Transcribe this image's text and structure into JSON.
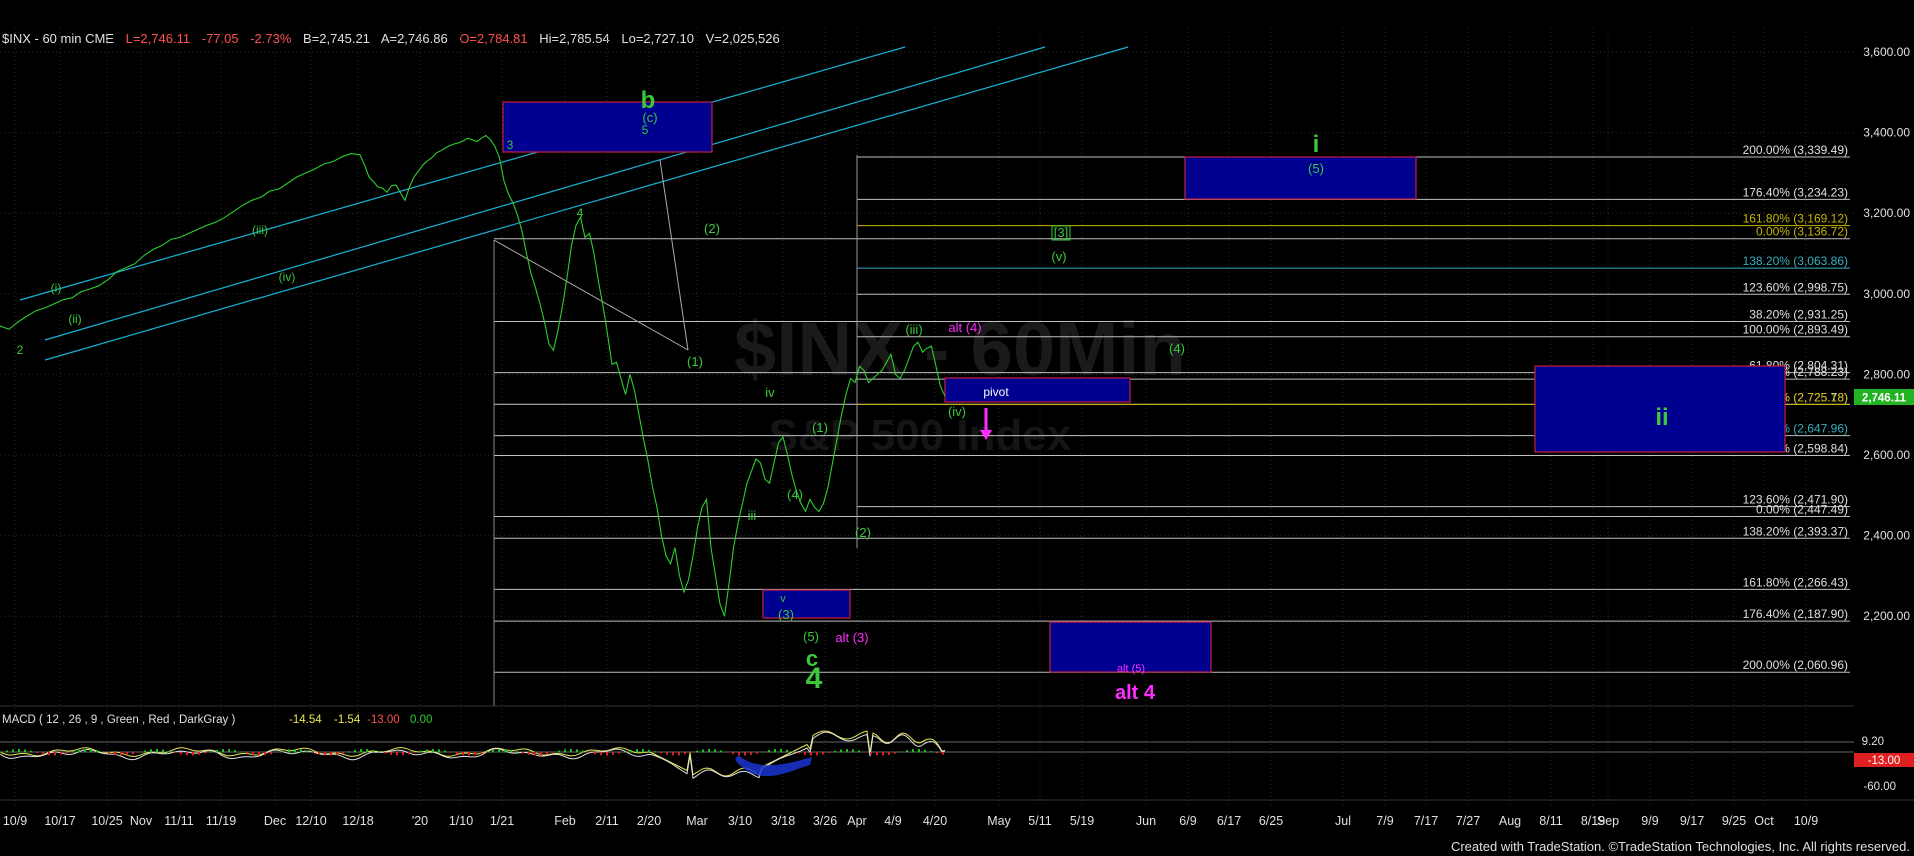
{
  "header": {
    "symbol": "$INX - 60 min  CME",
    "last": "L=2,746.11",
    "change": "-77.05",
    "pct": "-2.73%",
    "bid": "B=2,745.21",
    "ask": "A=2,746.86",
    "open": "O=2,784.81",
    "high": "Hi=2,785.54",
    "low": "Lo=2,727.10",
    "volume": "V=2,025,526"
  },
  "watermark": {
    "line1": "$INX - 60Min",
    "line2": "S&P 500 Index"
  },
  "macd": {
    "label": "MACD ( 12 , 26 , 9 , Green , Red , DarkGray )",
    "v1": "-14.54",
    "v2": "-1.54",
    "v3": "-13.00",
    "v4": "0.00",
    "axis_top": "9.20",
    "axis_last": "-13.00",
    "axis_bottom": "-60.00"
  },
  "footer": "Created with TradeStation. ©TradeStation Technologies, Inc. All rights reserved.",
  "colors": {
    "price": "#2ecc2e",
    "channel": "#17b3d8",
    "fib_line": "#c0c0c0",
    "box_fill": "#000090",
    "box_border": "#c02040",
    "wave_green": "#3cc83c",
    "wave_magenta": "#ff2cff",
    "last_price_bg": "#22b222"
  },
  "chart_data": {
    "type": "line",
    "title": "$INX - 60 min",
    "y_axis": {
      "ticks": [
        3600,
        3400,
        3200,
        3000,
        2800,
        2600,
        2400,
        2200
      ],
      "tick_labels": [
        "3,600.00",
        "3,400.00",
        "3,200.00",
        "3,000.00",
        "2,800.00",
        "2,600.00",
        "2,400.00",
        "2,200.00"
      ],
      "ylim": [
        2005,
        3610
      ]
    },
    "x_axis": {
      "labels": [
        "10/9",
        "10/17",
        "10/25",
        "Nov",
        "11/11",
        "11/19",
        "Dec",
        "12/10",
        "12/18",
        "'20",
        "1/10",
        "1/21",
        "Feb",
        "2/11",
        "2/20",
        "Mar",
        "3/10",
        "3/18",
        "3/26",
        "Apr",
        "4/9",
        "4/20",
        "May",
        "5/11",
        "5/19",
        "Jun",
        "6/9",
        "6/17",
        "6/25",
        "Jul",
        "7/9",
        "7/17",
        "7/27",
        "Aug",
        "8/11",
        "8/19",
        "Sep",
        "9/9",
        "9/17",
        "9/25",
        "Oct",
        "10/9"
      ]
    },
    "last_price": {
      "value": 2746.11,
      "label": "2,746.11"
    },
    "series": [
      {
        "values": [
          [
            0,
            2920
          ],
          [
            2,
            2912
          ],
          [
            4,
            2930
          ],
          [
            6,
            2945
          ],
          [
            8,
            2958
          ],
          [
            10,
            2965
          ],
          [
            12,
            2975
          ],
          [
            14,
            2985
          ],
          [
            16,
            2990
          ],
          [
            18,
            3005
          ],
          [
            20,
            3012
          ],
          [
            22,
            3020
          ],
          [
            24,
            3035
          ],
          [
            26,
            3055
          ],
          [
            28,
            3065
          ],
          [
            30,
            3075
          ],
          [
            32,
            3095
          ],
          [
            34,
            3110
          ],
          [
            36,
            3120
          ],
          [
            38,
            3135
          ],
          [
            40,
            3140
          ],
          [
            42,
            3150
          ],
          [
            44,
            3160
          ],
          [
            46,
            3170
          ],
          [
            48,
            3178
          ],
          [
            50,
            3190
          ],
          [
            52,
            3205
          ],
          [
            54,
            3220
          ],
          [
            56,
            3232
          ],
          [
            58,
            3240
          ],
          [
            60,
            3255
          ],
          [
            62,
            3260
          ],
          [
            64,
            3275
          ],
          [
            66,
            3290
          ],
          [
            68,
            3300
          ],
          [
            70,
            3310
          ],
          [
            72,
            3322
          ],
          [
            74,
            3328
          ],
          [
            76,
            3340
          ],
          [
            78,
            3348
          ],
          [
            80,
            3345
          ],
          [
            81,
            3320
          ],
          [
            82,
            3290
          ],
          [
            83,
            3278
          ],
          [
            84,
            3265
          ],
          [
            85,
            3262
          ],
          [
            86,
            3252
          ],
          [
            87,
            3268
          ],
          [
            88,
            3270
          ],
          [
            89,
            3250
          ],
          [
            90,
            3232
          ],
          [
            91,
            3265
          ],
          [
            92,
            3290
          ],
          [
            93,
            3305
          ],
          [
            94,
            3320
          ],
          [
            95,
            3330
          ],
          [
            96,
            3338
          ],
          [
            97,
            3350
          ],
          [
            98,
            3355
          ],
          [
            99,
            3362
          ],
          [
            100,
            3368
          ],
          [
            101,
            3372
          ],
          [
            102,
            3375
          ],
          [
            103,
            3380
          ],
          [
            104,
            3386
          ],
          [
            105,
            3382
          ],
          [
            106,
            3378
          ],
          [
            107,
            3386
          ],
          [
            108,
            3393
          ],
          [
            109,
            3382
          ],
          [
            110,
            3365
          ],
          [
            111,
            3337
          ],
          [
            112,
            3280
          ],
          [
            113,
            3248
          ],
          [
            114,
            3225
          ],
          [
            115,
            3195
          ],
          [
            116,
            3155
          ],
          [
            117,
            3100
          ],
          [
            118,
            3050
          ],
          [
            119,
            3015
          ],
          [
            120,
            2975
          ],
          [
            121,
            2930
          ],
          [
            122,
            2875
          ],
          [
            123,
            2860
          ],
          [
            124,
            2910
          ],
          [
            125,
            2970
          ],
          [
            126,
            3040
          ],
          [
            127,
            3120
          ],
          [
            128,
            3170
          ],
          [
            129,
            3190
          ],
          [
            130,
            3140
          ],
          [
            131,
            3150
          ],
          [
            132,
            3100
          ],
          [
            133,
            3030
          ],
          [
            134,
            2970
          ],
          [
            135,
            2900
          ],
          [
            136,
            2825
          ],
          [
            137,
            2830
          ],
          [
            138,
            2790
          ],
          [
            139,
            2750
          ],
          [
            140,
            2800
          ],
          [
            141,
            2760
          ],
          [
            142,
            2700
          ],
          [
            143,
            2640
          ],
          [
            144,
            2585
          ],
          [
            145,
            2520
          ],
          [
            146,
            2470
          ],
          [
            147,
            2400
          ],
          [
            148,
            2350
          ],
          [
            149,
            2330
          ],
          [
            150,
            2370
          ],
          [
            151,
            2300
          ],
          [
            152,
            2260
          ],
          [
            153,
            2290
          ],
          [
            154,
            2350
          ],
          [
            155,
            2420
          ],
          [
            156,
            2470
          ],
          [
            157,
            2490
          ],
          [
            158,
            2370
          ],
          [
            159,
            2300
          ],
          [
            160,
            2230
          ],
          [
            161,
            2200
          ],
          [
            162,
            2280
          ],
          [
            163,
            2370
          ],
          [
            164,
            2430
          ],
          [
            165,
            2480
          ],
          [
            166,
            2530
          ],
          [
            167,
            2560
          ],
          [
            168,
            2590
          ],
          [
            169,
            2580
          ],
          [
            170,
            2540
          ],
          [
            171,
            2530
          ],
          [
            172,
            2580
          ],
          [
            173,
            2630
          ],
          [
            174,
            2645
          ],
          [
            175,
            2600
          ],
          [
            176,
            2550
          ],
          [
            177,
            2510
          ],
          [
            178,
            2480
          ],
          [
            179,
            2460
          ],
          [
            180,
            2490
          ],
          [
            181,
            2470
          ],
          [
            182,
            2460
          ],
          [
            183,
            2480
          ],
          [
            184,
            2520
          ],
          [
            185,
            2580
          ],
          [
            186,
            2640
          ],
          [
            187,
            2700
          ],
          [
            188,
            2750
          ],
          [
            189,
            2790
          ],
          [
            190,
            2780
          ],
          [
            191,
            2820
          ],
          [
            192,
            2810
          ],
          [
            193,
            2780
          ],
          [
            194,
            2790
          ],
          [
            195,
            2800
          ],
          [
            196,
            2810
          ],
          [
            197,
            2830
          ],
          [
            198,
            2850
          ],
          [
            199,
            2800
          ],
          [
            200,
            2790
          ],
          [
            201,
            2810
          ],
          [
            202,
            2840
          ],
          [
            203,
            2870
          ],
          [
            204,
            2880
          ],
          [
            205,
            2855
          ],
          [
            206,
            2865
          ],
          [
            207,
            2870
          ],
          [
            208,
            2820
          ],
          [
            209,
            2770
          ],
          [
            210,
            2746
          ]
        ]
      }
    ],
    "fib_levels": [
      {
        "label": "200.00% (3,339.49)",
        "value": 3339.49
      },
      {
        "label": "176.40% (3,234.23)",
        "value": 3234.23
      },
      {
        "label": "161.80% (3,169.12)",
        "value": 3169.12
      },
      {
        "label": "0.00% (3,136.72)",
        "value": 3136.72
      },
      {
        "label": "138.20% (3,063.86)",
        "value": 3063.86
      },
      {
        "label": "123.60% (2,998.75)",
        "value": 2998.75
      },
      {
        "label": "38.20% (2,931.25)",
        "value": 2931.25
      },
      {
        "label": "100.00% (2,893.49)",
        "value": 2893.49
      },
      {
        "label": "61.80% (2,804.31)",
        "value": 2804.31
      },
      {
        "label": "76.40% (2,788.23)",
        "value": 2788.23
      },
      {
        "label": "50.00% (2,725.78)",
        "value": 2725.78
      },
      {
        "label": "61.80% (2,725.18)",
        "value": 2725.18
      },
      {
        "label": "38.20% (2,647.96)",
        "value": 2647.96
      },
      {
        "label": "100.00% (2,598.84)",
        "value": 2598.84
      },
      {
        "label": "123.60% (2,471.90)",
        "value": 2471.9
      },
      {
        "label": "0.00% (2,447.49)",
        "value": 2447.49
      },
      {
        "label": "138.20% (2,393.37)",
        "value": 2393.37
      },
      {
        "label": "161.80% (2,266.43)",
        "value": 2266.43
      },
      {
        "label": "176.40% (2,187.90)",
        "value": 2187.9
      },
      {
        "label": "200.00% (2,060.96)",
        "value": 2060.96
      }
    ],
    "wave_labels": [
      {
        "text": "b",
        "emphasis": "large"
      },
      {
        "text": "(c)"
      },
      {
        "text": "3"
      },
      {
        "text": "5"
      },
      {
        "text": "4"
      },
      {
        "text": "(iii)"
      },
      {
        "text": "(iv)"
      },
      {
        "text": "(i)"
      },
      {
        "text": "(ii)"
      },
      {
        "text": "2"
      },
      {
        "text": "(2)"
      },
      {
        "text": "(1)"
      },
      {
        "text": "iv"
      },
      {
        "text": "iii"
      },
      {
        "text": "(4)"
      },
      {
        "text": "v"
      },
      {
        "text": "(3)"
      },
      {
        "text": "(5)"
      },
      {
        "text": "c",
        "emphasis": "large"
      },
      {
        "text": "4",
        "emphasis": "large"
      },
      {
        "text": "(1)"
      },
      {
        "text": "(2)"
      },
      {
        "text": "(iii)"
      },
      {
        "text": "(iv)"
      },
      {
        "text": "[3]",
        "emphasis": "boxed"
      },
      {
        "text": "(v)"
      },
      {
        "text": "(4)"
      },
      {
        "text": "i",
        "emphasis": "large"
      },
      {
        "text": "(5)"
      },
      {
        "text": "ii",
        "emphasis": "large"
      },
      {
        "text": "alt (4)",
        "color": "magenta"
      },
      {
        "text": "alt (3)",
        "color": "magenta"
      },
      {
        "text": "alt (5)",
        "color": "magenta"
      },
      {
        "text": "alt 4",
        "color": "magenta",
        "emphasis": "large"
      },
      {
        "text": "pivot",
        "color": "white"
      }
    ]
  }
}
